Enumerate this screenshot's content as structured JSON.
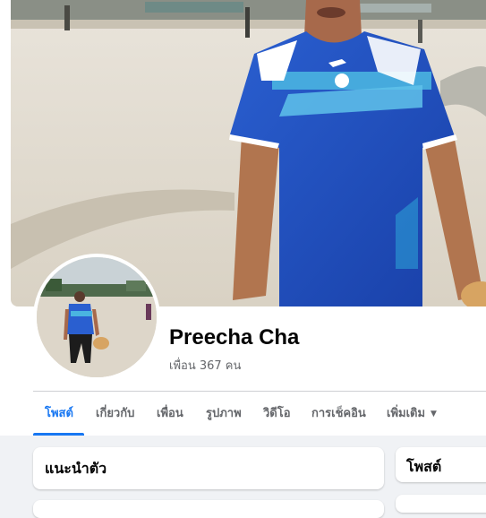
{
  "profile": {
    "name": "Preecha Cha",
    "friends_label": "เพื่อน 367 คน"
  },
  "tabs": [
    {
      "label": "โพสต์",
      "active": true
    },
    {
      "label": "เกี่ยวกับ",
      "active": false
    },
    {
      "label": "เพื่อน",
      "active": false
    },
    {
      "label": "รูปภาพ",
      "active": false
    },
    {
      "label": "วิดีโอ",
      "active": false
    },
    {
      "label": "การเช็คอิน",
      "active": false
    },
    {
      "label": "เพิ่มเติม",
      "active": false,
      "chevron": "▼"
    }
  ],
  "cards": {
    "intro_title": "แนะนำตัว",
    "posts_title": "โพสต์"
  },
  "colors": {
    "accent": "#1877f2",
    "page_bg": "#f0f2f5",
    "text_secondary": "#65676b"
  },
  "icons": [
    "chevron-down-icon",
    "camera-icon"
  ]
}
